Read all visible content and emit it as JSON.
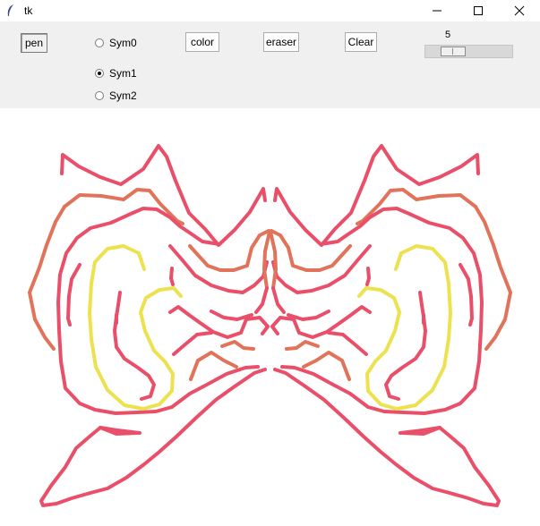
{
  "window": {
    "title": "tk"
  },
  "toolbar": {
    "pen_label": "pen",
    "color_label": "color",
    "eraser_label": "eraser",
    "clear_label": "Clear",
    "radios": [
      {
        "label": "Sym0",
        "selected": false
      },
      {
        "label": "Sym1",
        "selected": true
      },
      {
        "label": "Sym2",
        "selected": false
      }
    ],
    "scale": {
      "value": "5",
      "fraction": 0.25
    }
  },
  "drawing": {
    "colors": {
      "red": "#ea4f6a",
      "orange": "#e0735a",
      "yellow": "#ece24f"
    },
    "stroke_description": "symmetric freehand butterfly-like curves"
  }
}
